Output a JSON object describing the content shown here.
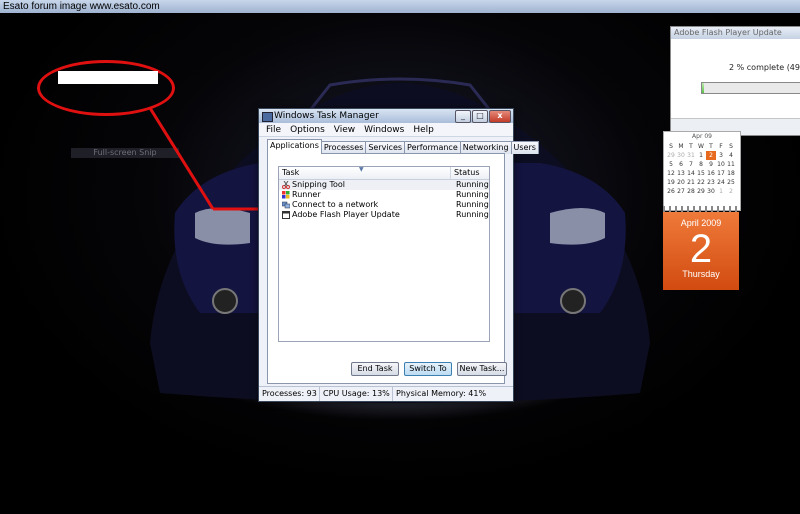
{
  "banner": {
    "text": "Esato forum image www.esato.com"
  },
  "annotation": {
    "snip_text": "Full-screen Snip"
  },
  "task_manager": {
    "title": "Windows Task Manager",
    "menu": [
      "File",
      "Options",
      "View",
      "Windows",
      "Help"
    ],
    "tabs": [
      "Applications",
      "Processes",
      "Services",
      "Performance",
      "Networking",
      "Users"
    ],
    "active_tab": "Applications",
    "columns": {
      "task": "Task",
      "status": "Status"
    },
    "rows": [
      {
        "task": "Snipping Tool",
        "status": "Running",
        "icon": "scissors-icon"
      },
      {
        "task": "Runner",
        "status": "Running",
        "icon": "windows-logo-icon"
      },
      {
        "task": "Connect to a network",
        "status": "Running",
        "icon": "network-icon"
      },
      {
        "task": "Adobe Flash Player Update",
        "status": "Running",
        "icon": "window-icon"
      }
    ],
    "buttons": {
      "end_task": "End Task",
      "switch_to": "Switch To",
      "new_task": "New Task..."
    },
    "status": {
      "processes": "Processes: 93",
      "cpu": "CPU Usage: 13%",
      "memory": "Physical Memory: 41%"
    },
    "window_buttons": {
      "minimize": "_",
      "maximize": "□",
      "close": "x"
    }
  },
  "flash_update": {
    "title": "Adobe Flash Player Update",
    "progress_text": "2 % complete (49 of 183",
    "progress_fraction": 0.02
  },
  "calendar": {
    "month_label": "Apr 09",
    "weekdays": [
      "S",
      "M",
      "T",
      "W",
      "T",
      "F",
      "S"
    ],
    "days": [
      [
        "29",
        "30",
        "31",
        "1",
        "2",
        "3",
        "4"
      ],
      [
        "5",
        "6",
        "7",
        "8",
        "9",
        "10",
        "11"
      ],
      [
        "12",
        "13",
        "14",
        "15",
        "16",
        "17",
        "18"
      ],
      [
        "19",
        "20",
        "21",
        "22",
        "23",
        "24",
        "25"
      ],
      [
        "26",
        "27",
        "28",
        "29",
        "30",
        "1",
        "2"
      ]
    ],
    "today_index": [
      0,
      4
    ],
    "month_year": "April 2009",
    "day_number": "2",
    "weekday": "Thursday",
    "accent": "#e86a1e"
  },
  "colors": {
    "annotation_red": "#e01010",
    "titlebar": "#a9bdd9"
  }
}
